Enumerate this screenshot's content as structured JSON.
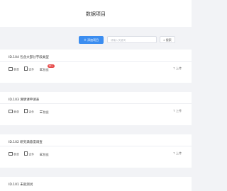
{
  "header": {
    "title": "数据项目"
  },
  "toolbar": {
    "add_label": "添加项目",
    "search_placeholder": "请输入关键词",
    "search_label": "搜索"
  },
  "cards": [
    {
      "title": "ID.104 包含大部分字段类型",
      "actions": [
        "表单",
        "证件",
        "数据"
      ],
      "badge": "99+",
      "upload": "上传"
    },
    {
      "title": "ID.103 清明课申请表",
      "actions": [
        "表单",
        "证件",
        "数据"
      ],
      "upload": "上传"
    },
    {
      "title": "ID.102 研究满意度调查",
      "actions": [
        "表单",
        "证件",
        "数据"
      ],
      "upload": "上传"
    },
    {
      "title": "ID.101 未就测试"
    }
  ]
}
